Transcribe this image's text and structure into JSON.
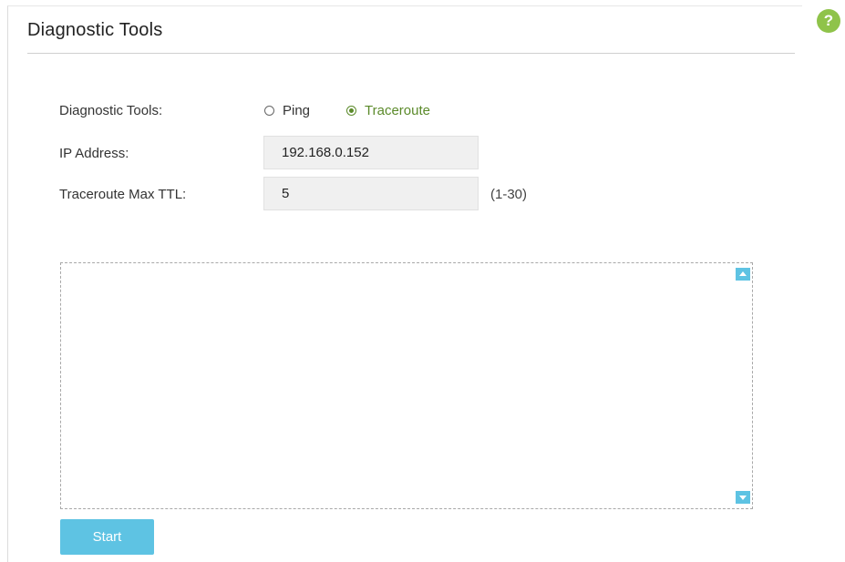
{
  "header": {
    "title": "Diagnostic Tools",
    "help_icon": "?"
  },
  "form": {
    "tool_label": "Diagnostic Tools:",
    "tool_options": [
      {
        "label": "Ping",
        "selected": false
      },
      {
        "label": "Traceroute",
        "selected": true
      }
    ],
    "ip_label": "IP Address:",
    "ip_value": "192.168.0.152",
    "ttl_label": "Traceroute Max TTL:",
    "ttl_value": "5",
    "ttl_hint": "(1-30)"
  },
  "output": {
    "text": ""
  },
  "actions": {
    "start_label": "Start"
  },
  "colors": {
    "accent": "#5ec3e3",
    "selected_green": "#5b8a2a",
    "help_green": "#8fc34a"
  }
}
